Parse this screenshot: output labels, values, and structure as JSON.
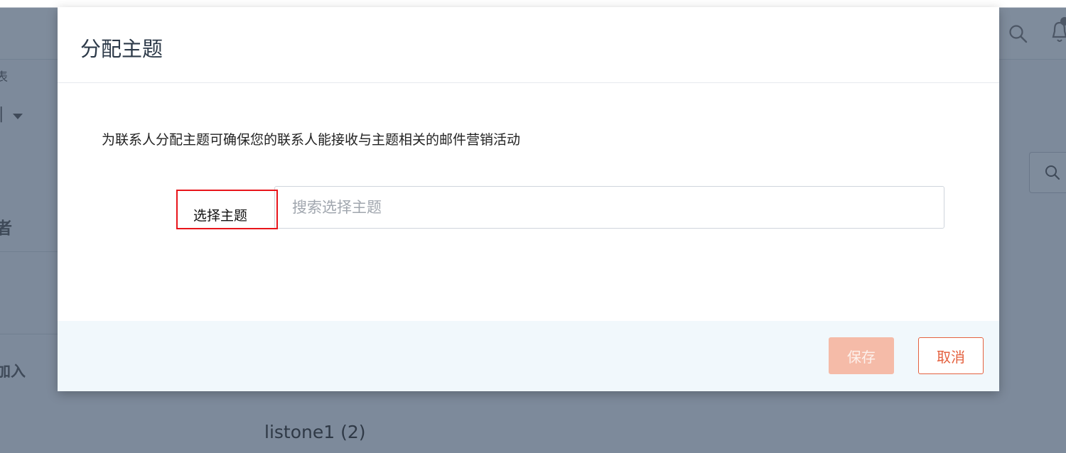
{
  "background": {
    "side_label_partial": "表",
    "side_dropdown_partial": "",
    "side_heading_partial": "者",
    "side_join_partial": "加入",
    "list_item": "listone1 (2)",
    "icons": [
      "search-icon",
      "bell-icon",
      "dropdown-caret-icon"
    ]
  },
  "modal": {
    "title": "分配主题",
    "description": "为联系人分配主题可确保您的联系人能接收与主题相关的邮件营销活动",
    "topic_label": "选择主题",
    "topic_placeholder": "搜索选择主题",
    "topic_value": "",
    "buttons": {
      "save": "保存",
      "cancel": "取消"
    }
  },
  "colors": {
    "overlay": "#7d8a9b",
    "accent": "#e4613f",
    "save_disabled": "#f5bba8",
    "highlight_border": "#e8141a",
    "footer_bg": "#f1f8fc"
  }
}
